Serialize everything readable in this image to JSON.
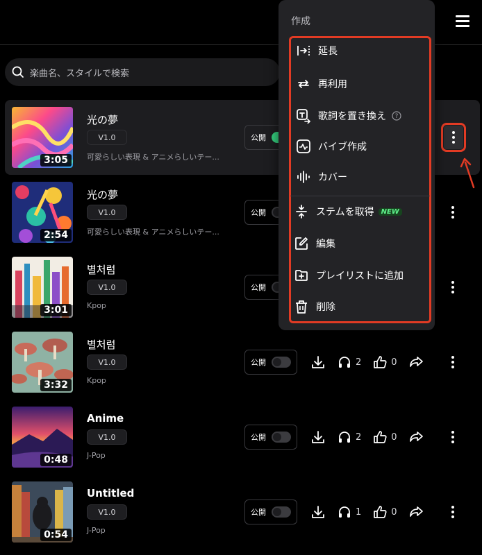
{
  "search": {
    "placeholder": "楽曲名、スタイルで検索"
  },
  "menu": {
    "header": "作成",
    "items": [
      {
        "label": "延長",
        "icon": "extend-icon"
      },
      {
        "label": "再利用",
        "icon": "reuse-icon"
      },
      {
        "label": "歌詞を置き換え",
        "icon": "replace-lyrics-icon"
      },
      {
        "label": "バイブ作成",
        "icon": "vibe-icon"
      },
      {
        "label": "カバー",
        "icon": "cover-icon"
      },
      {
        "label": "ステムを取得",
        "icon": "stems-icon",
        "badge": "NEW"
      },
      {
        "label": "編集",
        "icon": "edit-icon"
      },
      {
        "label": "プレイリストに追加",
        "icon": "add-playlist-icon"
      },
      {
        "label": "削除",
        "icon": "trash-icon"
      }
    ]
  },
  "songs": [
    {
      "title": "光の夢",
      "version": "V1.0",
      "duration": "3:05",
      "description": "可愛らしい表現 & アニメらしいテー...",
      "public_label": "公開",
      "public_on": true,
      "plays": "",
      "likes": ""
    },
    {
      "title": "光の夢",
      "version": "V1.0",
      "duration": "2:54",
      "description": "可愛らしい表現 & アニメらしいテー...",
      "public_label": "公開",
      "public_on": false,
      "plays": "",
      "likes": ""
    },
    {
      "title": "별처럼",
      "version": "V1.0",
      "duration": "3:01",
      "description": "Kpop",
      "public_label": "公開",
      "public_on": false,
      "plays": "",
      "likes": ""
    },
    {
      "title": "별처럼",
      "version": "V1.0",
      "duration": "3:32",
      "description": "Kpop",
      "public_label": "公開",
      "public_on": false,
      "plays": "2",
      "likes": "0"
    },
    {
      "title": "Anime",
      "version": "V1.0",
      "duration": "0:48",
      "description": "J-Pop",
      "public_label": "公開",
      "public_on": false,
      "plays": "2",
      "likes": "0"
    },
    {
      "title": "Untitled",
      "version": "V1.0",
      "duration": "0:54",
      "description": "J-Pop",
      "public_label": "公開",
      "public_on": false,
      "plays": "1",
      "likes": "0"
    }
  ],
  "colors": {
    "highlight": "#e23b24",
    "toggle_on": "#35d07f",
    "new_badge": "#5ef08a"
  }
}
